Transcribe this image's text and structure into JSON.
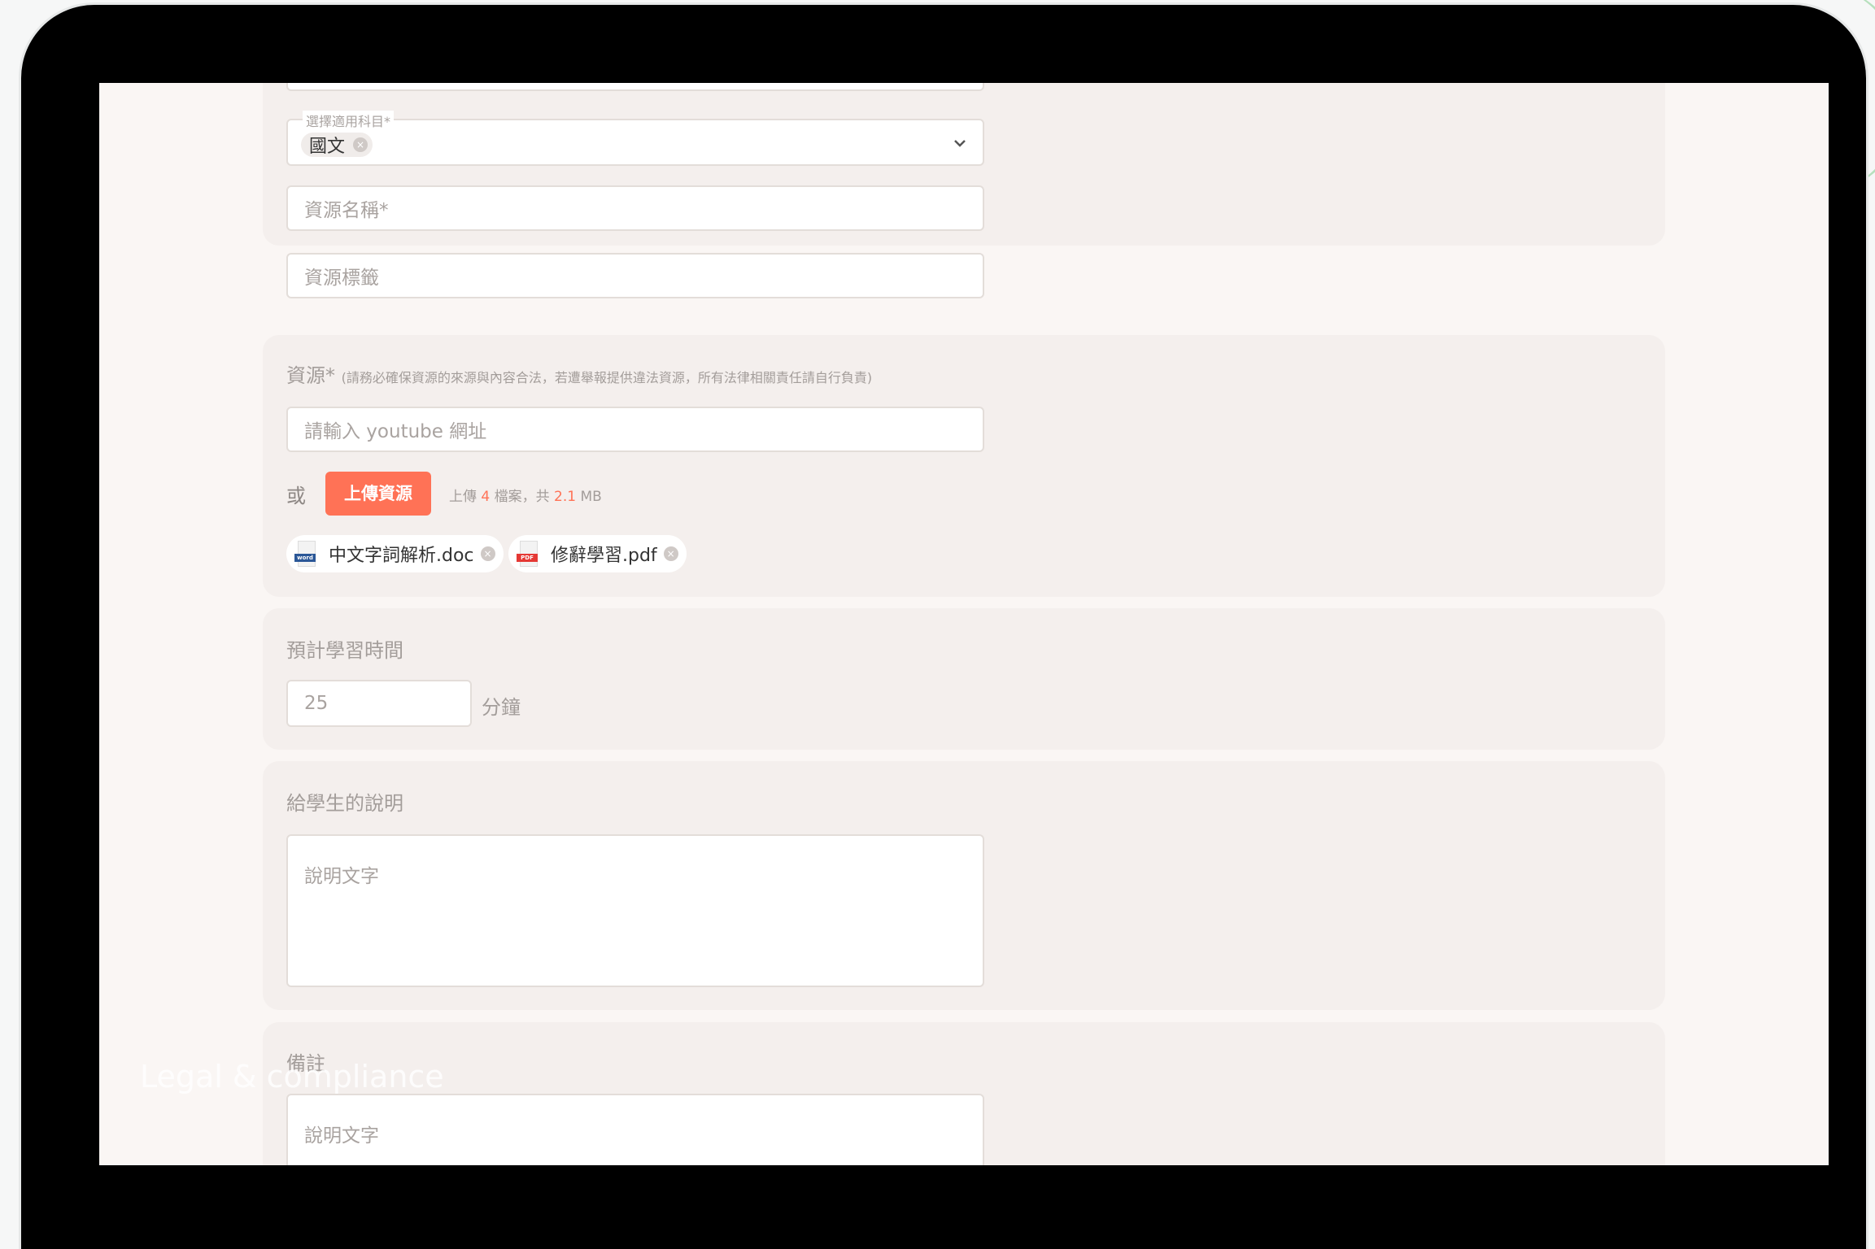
{
  "subject": {
    "label": "選擇適用科目*",
    "selected": "國文",
    "chip_remove": "×"
  },
  "resource_name": {
    "placeholder": "資源名稱*"
  },
  "resource_tags": {
    "placeholder": "資源標籤"
  },
  "resource": {
    "label": "資源*",
    "note": "(請務必確保資源的來源與內容合法，若遭舉報提供違法資源，所有法律相關責任請自行負責)",
    "youtube_placeholder": "請輸入 youtube 網址",
    "or": "或",
    "upload_button": "上傳資源",
    "upload_info_prefix": "上傳",
    "file_count": "4",
    "upload_info_mid": "檔案，共",
    "total_size": "2.1",
    "size_unit": "MB",
    "files": [
      {
        "name": "中文字詞解析.doc",
        "type_tag": "word",
        "icon": "word-file-icon",
        "tag_color": "#2b5797"
      },
      {
        "name": "修辭學習.pdf",
        "type_tag": "PDF",
        "icon": "pdf-file-icon",
        "tag_color": "#e53935"
      }
    ]
  },
  "study_time": {
    "label": "預計學習時間",
    "value": "25",
    "unit": "分鐘"
  },
  "student_note": {
    "label": "給學生的說明",
    "placeholder": "說明文字"
  },
  "remarks": {
    "label": "備註",
    "placeholder": "說明文字"
  },
  "watermark": "Legal & compliance",
  "colors": {
    "accent": "#ff7256",
    "card_bg": "#f4efed",
    "screen_bg": "#faf6f4",
    "bezel": "#000000"
  }
}
